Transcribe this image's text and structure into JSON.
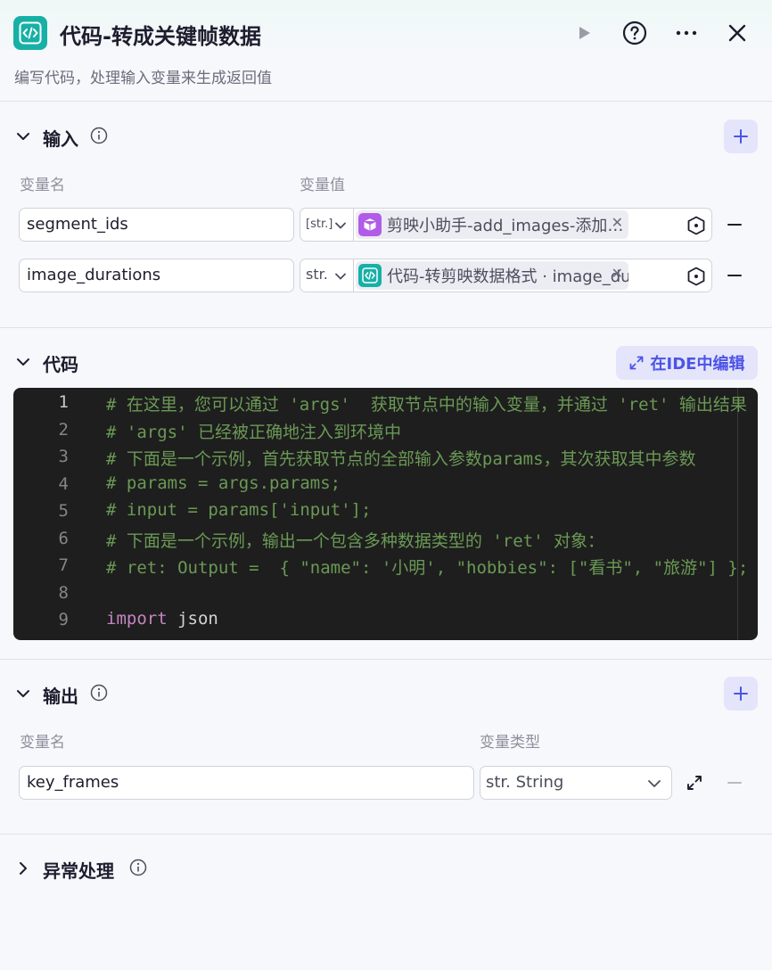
{
  "header": {
    "title": "代码-转成关键帧数据",
    "subtitle": "编写代码，处理输入变量来生成返回值"
  },
  "input_section": {
    "title": "输入",
    "col_name": "变量名",
    "col_value": "变量值",
    "rows": [
      {
        "name": "segment_ids",
        "type": "[str.]",
        "ref_text": "剪映小助手-add_images-添加…",
        "ref_suffix": "-",
        "ref_color": "#b15ce8"
      },
      {
        "name": "image_durations",
        "type": "str.",
        "ref_text": "代码-转剪映数据格式 · image_du…",
        "ref_suffix": "",
        "ref_color": "#17b0a6"
      }
    ]
  },
  "code_section": {
    "title": "代码",
    "ide_label": "在IDE中编辑",
    "lines": [
      {
        "n": "1",
        "text": "# 在这里，您可以通过 'args'  获取节点中的输入变量，并通过 'ret' 输出结果"
      },
      {
        "n": "2",
        "text": "# 'args' 已经被正确地注入到环境中"
      },
      {
        "n": "3",
        "text": "# 下面是一个示例，首先获取节点的全部输入参数params，其次获取其中参数"
      },
      {
        "n": "4",
        "text": "# params = args.params;"
      },
      {
        "n": "5",
        "text": "# input = params['input'];"
      },
      {
        "n": "6",
        "text": "# 下面是一个示例，输出一个包含多种数据类型的 'ret' 对象："
      },
      {
        "n": "7",
        "text": "# ret: Output =  { \"name\": '小明', \"hobbies\": [\"看书\", \"旅游\"] };"
      },
      {
        "n": "8",
        "text": ""
      },
      {
        "n": "9",
        "kw": "import",
        "rest": " json"
      }
    ]
  },
  "output_section": {
    "title": "输出",
    "col_name": "变量名",
    "col_type": "变量类型",
    "rows": [
      {
        "name": "key_frames",
        "type": "str. String"
      }
    ]
  },
  "exception_section": {
    "title": "异常处理"
  },
  "colors": {
    "accent": "#4d53e8",
    "code_node": "#17b0a6",
    "plugin_node": "#b15ce8"
  }
}
